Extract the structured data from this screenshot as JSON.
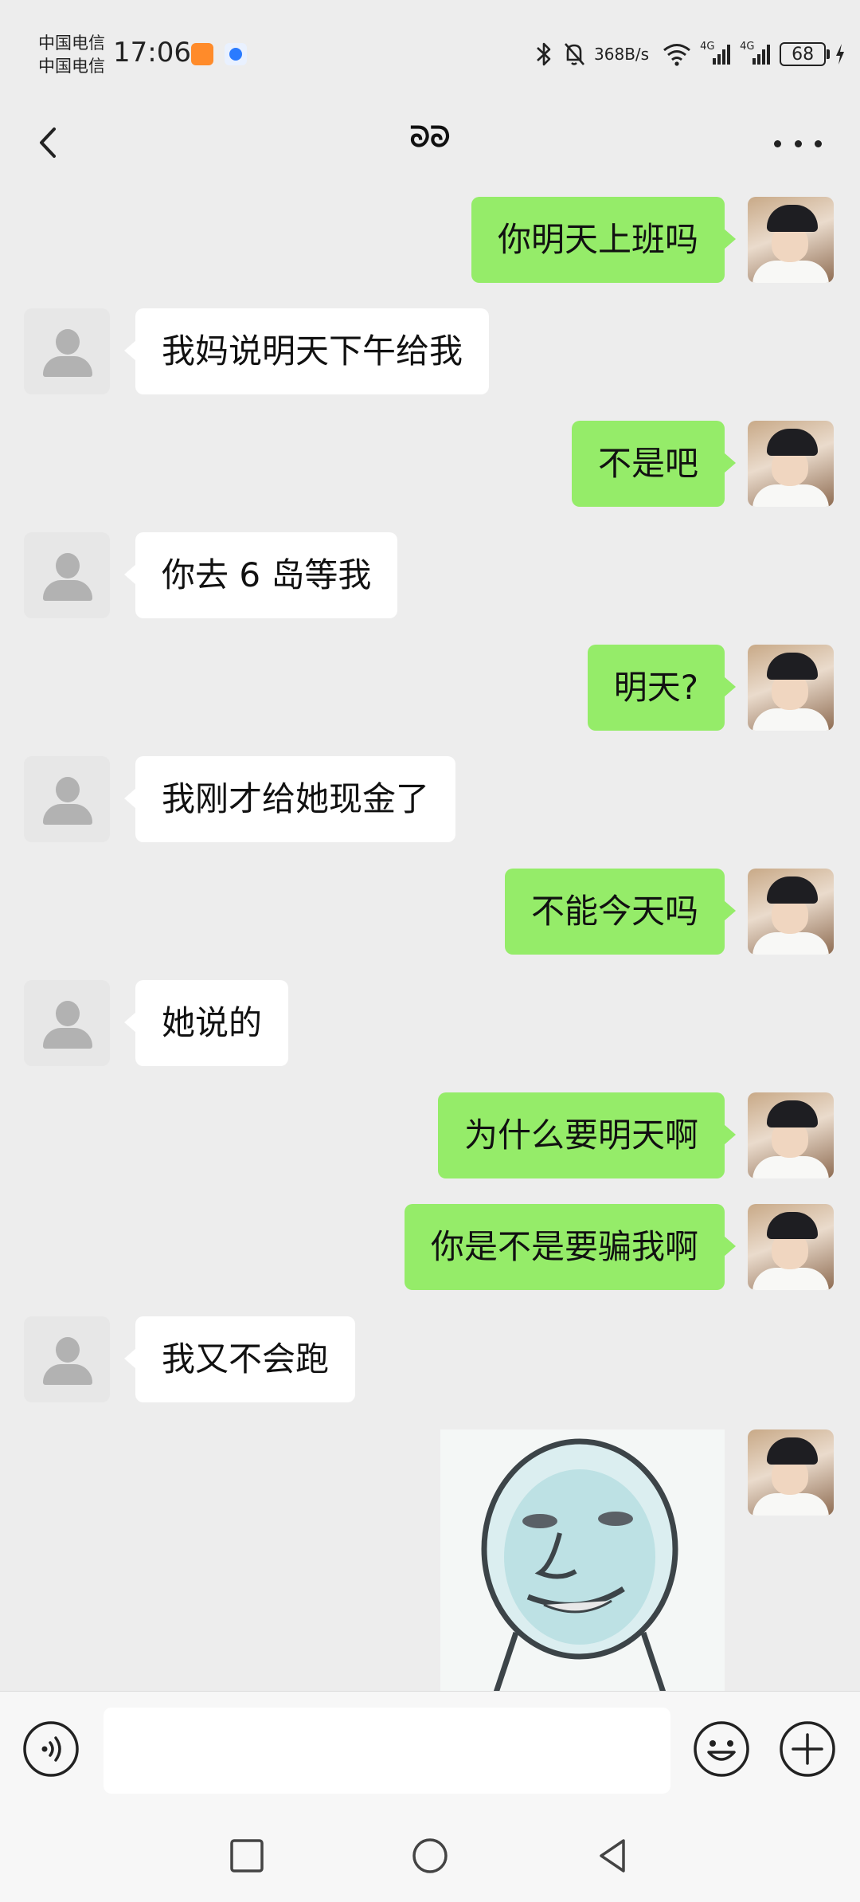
{
  "status_bar": {
    "carrier_1": "中国电信",
    "carrier_2": "中国电信",
    "time": "17:06",
    "net_speed_value": "368",
    "net_speed_unit": "B/s",
    "signal_1": "4G",
    "signal_2": "4G",
    "battery": "68"
  },
  "header": {
    "title": "ᘐᘐ"
  },
  "messages": [
    {
      "from": "me",
      "text": "你明天上班吗"
    },
    {
      "from": "other",
      "text": "我妈说明天下午给我"
    },
    {
      "from": "me",
      "text": "不是吧"
    },
    {
      "from": "other",
      "text": "你去 6 岛等我"
    },
    {
      "from": "me",
      "text": "明天?"
    },
    {
      "from": "other",
      "text": "我刚才给她现金了"
    },
    {
      "from": "me",
      "text": "不能今天吗"
    },
    {
      "from": "other",
      "text": "她说的"
    },
    {
      "from": "me",
      "text": "为什么要明天啊"
    },
    {
      "from": "me",
      "text": "你是不是要骗我啊"
    },
    {
      "from": "other",
      "text": "我又不会跑"
    },
    {
      "from": "me",
      "type": "sticker"
    }
  ],
  "input": {
    "value": "",
    "placeholder": ""
  },
  "icons": {
    "back": "back-arrow-icon",
    "more": "more-icon",
    "voice": "voice-icon",
    "emoji": "emoji-icon",
    "plus": "plus-icon"
  },
  "colors": {
    "my_bubble": "#95ec69",
    "other_bubble": "#ffffff",
    "background": "#ededed"
  }
}
